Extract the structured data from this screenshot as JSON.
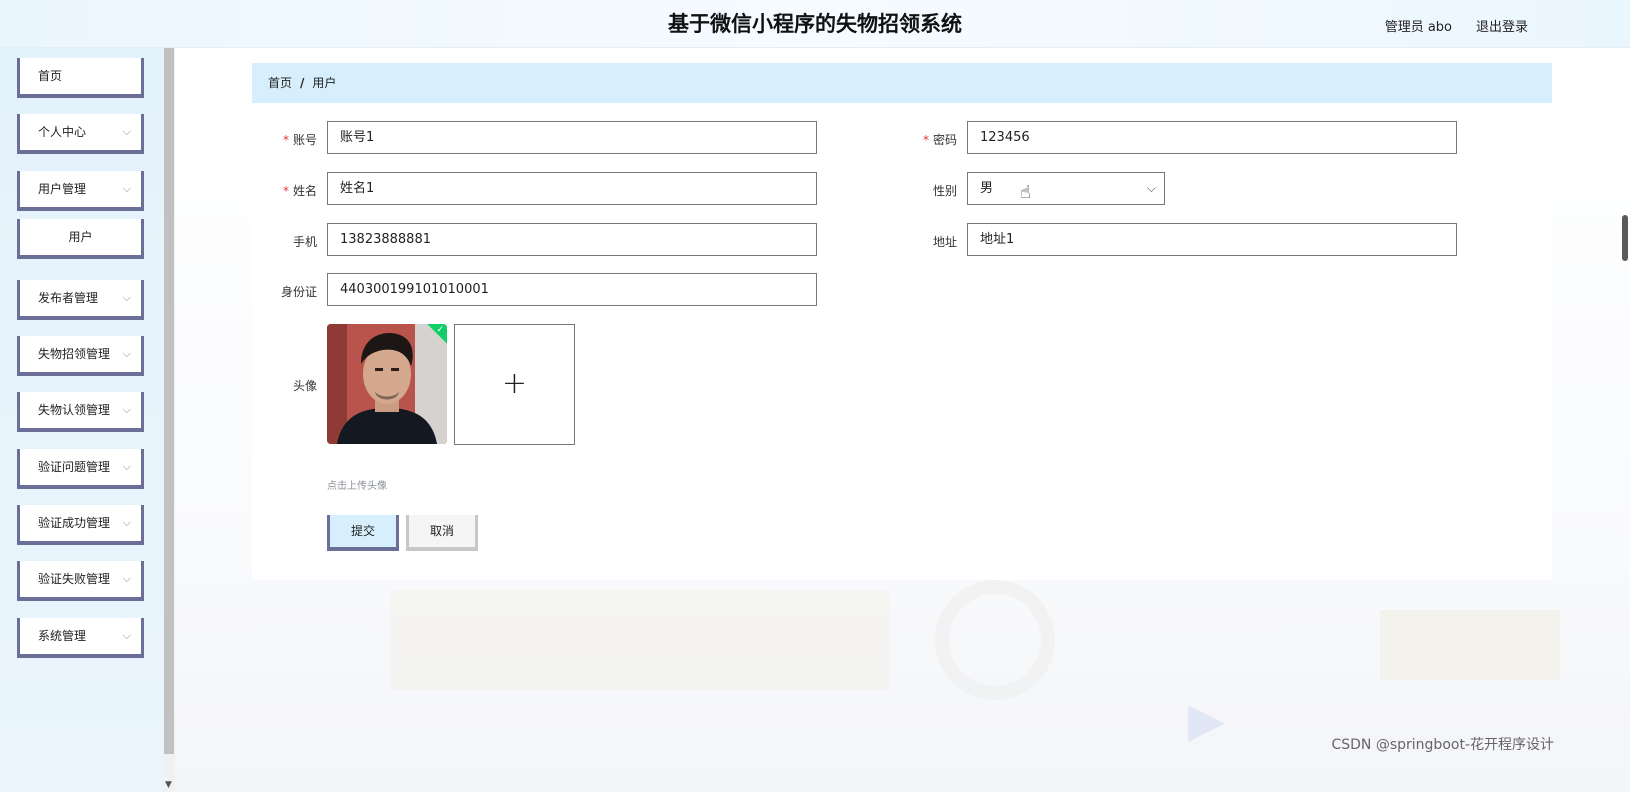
{
  "header": {
    "title": "基于微信小程序的失物招领系统",
    "user": "管理员 abo",
    "logout": "退出登录"
  },
  "sidebar": {
    "items": [
      {
        "label": "首页"
      },
      {
        "label": "个人中心"
      },
      {
        "label": "用户管理"
      },
      {
        "label": "用户"
      },
      {
        "label": "发布者管理"
      },
      {
        "label": "失物招领管理"
      },
      {
        "label": "失物认领管理"
      },
      {
        "label": "验证问题管理"
      },
      {
        "label": "验证成功管理"
      },
      {
        "label": "验证失败管理"
      },
      {
        "label": "系统管理"
      }
    ],
    "chevron": "⌵"
  },
  "breadcrumb": {
    "home": "首页",
    "sep": "/",
    "current": "用户"
  },
  "form": {
    "account": {
      "label": "账号",
      "value": "账号1"
    },
    "password": {
      "label": "密码",
      "value": "123456"
    },
    "name": {
      "label": "姓名",
      "value": "姓名1"
    },
    "gender": {
      "label": "性别",
      "value": "男"
    },
    "phone": {
      "label": "手机",
      "value": "13823888881"
    },
    "address": {
      "label": "地址",
      "value": "地址1"
    },
    "idcard": {
      "label": "身份证",
      "value": "440300199101010001"
    },
    "avatar": {
      "label": "头像",
      "hint": "点击上传头像"
    },
    "required_mark": "*",
    "submit": "提交",
    "cancel": "取消"
  },
  "icons": {
    "plus": "+",
    "check": "✓",
    "hand": "☝"
  },
  "watermark": "CSDN @springboot-花开程序设计",
  "colors": {
    "menu_border": "#6b6f98",
    "breadcrumb_bg": "#d7eefc",
    "required": "#e4393c",
    "check_badge": "#13ce66"
  }
}
